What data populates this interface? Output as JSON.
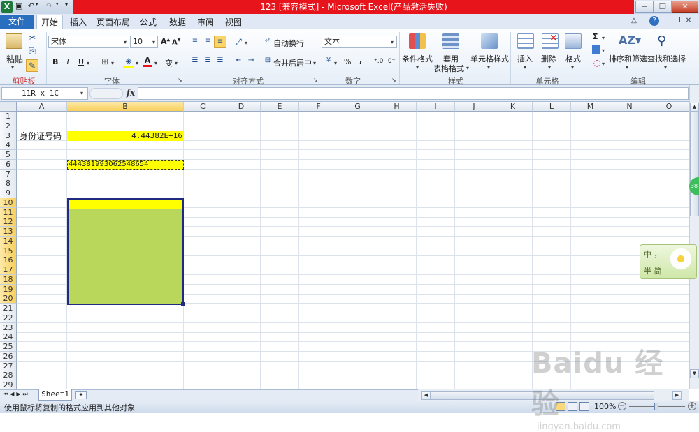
{
  "title_bar": {
    "title": "123  [兼容模式]  -  Microsoft Excel(产品激活失败)",
    "app_icon_label": "X"
  },
  "ribbon_tabs": {
    "file": "文件",
    "items": [
      "开始",
      "插入",
      "页面布局",
      "公式",
      "数据",
      "审阅",
      "视图"
    ]
  },
  "ribbon": {
    "clipboard": {
      "paste": "粘贴",
      "group_label": "剪贴板"
    },
    "font": {
      "font_name": "宋体",
      "font_size": "10",
      "group_label": "字体"
    },
    "alignment": {
      "wrap_text": "自动换行",
      "merge_center": "合并后居中",
      "group_label": "对齐方式"
    },
    "number": {
      "format": "文本",
      "percent": "%",
      "comma": ",",
      "group_label": "数字"
    },
    "styles": {
      "conditional": "条件格式",
      "table_line1": "套用",
      "table_line2": "表格格式",
      "cell_styles": "单元格样式",
      "group_label": "样式"
    },
    "cells": {
      "insert": "插入",
      "delete": "删除",
      "format": "格式",
      "group_label": "单元格"
    },
    "editing": {
      "sort_filter": "排序和筛选",
      "find_select": "查找和选择",
      "group_label": "编辑"
    }
  },
  "formula_bar": {
    "name_box": "11R x 1C",
    "fx": "fx",
    "value": ""
  },
  "grid": {
    "columns": [
      "A",
      "B",
      "C",
      "D",
      "E",
      "F",
      "G",
      "H",
      "I",
      "J",
      "K",
      "L",
      "M",
      "N",
      "O"
    ],
    "rows": [
      "1",
      "2",
      "3",
      "4",
      "5",
      "6",
      "7",
      "8",
      "9",
      "10",
      "11",
      "12",
      "13",
      "14",
      "15",
      "16",
      "17",
      "18",
      "19",
      "20",
      "21",
      "22",
      "23",
      "24",
      "25",
      "26",
      "27",
      "28",
      "29"
    ],
    "cells": {
      "A3": "身份证号码",
      "B3": "4.44382E+16",
      "B6": "444381993062548654"
    }
  },
  "sheet_tabs": {
    "active": "Sheet1"
  },
  "status_bar": {
    "message": "使用鼠标将复制的格式应用到其他对象",
    "zoom": "100%"
  },
  "ime_widget": {
    "line1": "中 ，",
    "line2": "半 简"
  },
  "badge": "38",
  "watermark": {
    "brand": "Baidu 经验",
    "url": "jingyan.baidu.com"
  },
  "colors": {
    "title_red": "#e8141c",
    "cell_yellow": "#ffff00",
    "selection_green": "#b9d75a",
    "selection_border": "#1f2a80"
  }
}
